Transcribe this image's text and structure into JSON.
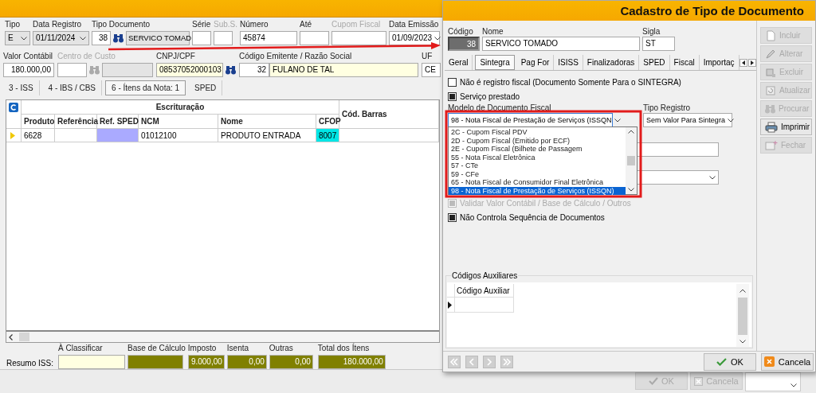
{
  "back_window": {
    "header_row_1": [
      {
        "kind": "combo",
        "label": "Tipo",
        "value": "E",
        "readonly": true,
        "disabled": false
      },
      {
        "kind": "combo",
        "label": "Data Registro",
        "value": "01/11/2024",
        "readonly": true,
        "disabled": false
      },
      {
        "kind": "lookup",
        "label": "Tipo Documento",
        "code": "38",
        "value": "SERVICO TOMAD",
        "readonly": true,
        "disabled": false
      },
      {
        "kind": "text",
        "label": "Série",
        "readonly": false,
        "disabled": false
      },
      {
        "kind": "text",
        "label": "Sub.S.",
        "readonly": false,
        "disabled": true
      },
      {
        "kind": "text",
        "label": "Número",
        "value": "45874",
        "readonly": false,
        "disabled": false
      },
      {
        "kind": "text",
        "label": "Até",
        "readonly": false,
        "disabled": false
      },
      {
        "kind": "text",
        "label": "Cupom Fiscal",
        "readonly": false,
        "disabled": true
      },
      {
        "kind": "combo",
        "label": "Data Emissão",
        "value": "01/09/2023",
        "readonly": false,
        "disabled": false
      }
    ],
    "header_row_2": [
      {
        "kind": "number",
        "label": "Valor Contábil",
        "value": "180.000,00",
        "highlighted": false,
        "disabled": false
      },
      {
        "kind": "lookup",
        "label": "Centro de Custo",
        "readonly": true,
        "disabled": true
      },
      {
        "kind": "search",
        "label": "CNPJ/CPF",
        "value": "08537052000103",
        "highlighted": true,
        "disabled": false
      },
      {
        "kind": "pair",
        "label": "Código Emitente / Razão Social",
        "code": "32",
        "value": "FULANO DE TAL",
        "highlighted": true,
        "disabled": false
      },
      {
        "kind": "text",
        "label": "UF",
        "value": "CE",
        "highlighted": false,
        "disabled": false
      }
    ],
    "tabs": [
      {
        "label": "3 - ISS",
        "selected": false
      },
      {
        "label": "4 - IBS / CBS",
        "selected": false
      },
      {
        "label": "6 - Ítens da Nota: 1",
        "selected": true
      },
      {
        "label": "SPED",
        "selected": false
      }
    ],
    "grid": {
      "group_header": "Escrituração",
      "columns": [
        "Produto",
        "Referência",
        "Ref. SPED",
        "NCM",
        "Nome",
        "CFOP"
      ],
      "extra_column": "Cód. Barras",
      "rows": [
        {
          "selected": true,
          "cells": [
            {
              "text": "6628"
            },
            {},
            {
              "color": "#aaaaff"
            },
            {
              "text": "01012100"
            },
            {
              "text": "PRODUTO ENTRADA"
            },
            {
              "text": "8007",
              "color": "#00e6e6"
            }
          ]
        }
      ]
    },
    "summary": {
      "label": "Resumo ISS:",
      "fields": [
        {
          "label": "À Classificar",
          "highlighted": true
        },
        {
          "label": "Base de Cálculo",
          "highlighted": false
        },
        {
          "label": "Imposto",
          "value": "9.000,00",
          "highlighted": false
        },
        {
          "label": "Isenta",
          "value": "0,00",
          "highlighted": false
        },
        {
          "label": "Outras",
          "value": "0,00",
          "highlighted": false
        },
        {
          "label": "Total dos Ítens",
          "value": "180.000,00",
          "highlighted": false
        }
      ]
    },
    "footer_buttons": [
      {
        "label": "OK",
        "disabled": true
      },
      {
        "label": "Cancela",
        "disabled": true
      }
    ]
  },
  "dialog": {
    "title": "Cadastro de Tipo de Documento",
    "codigo": {
      "label": "Código",
      "value": "38"
    },
    "nome": {
      "label": "Nome",
      "value": "SERVICO TOMADO"
    },
    "sigla": {
      "label": "Sigla",
      "value": "ST"
    },
    "tabs": [
      {
        "label": "Geral",
        "selected": false
      },
      {
        "label": "Sintegra",
        "selected": true
      },
      {
        "label": "Pag For",
        "selected": false
      },
      {
        "label": "ISISS",
        "selected": false
      },
      {
        "label": "Finalizadoras",
        "selected": false
      },
      {
        "label": "SPED",
        "selected": false
      },
      {
        "label": "Fiscal",
        "selected": false
      },
      {
        "label": "Importaç",
        "selected": false
      }
    ],
    "options_top": [
      {
        "label": "Não é registro fiscal (Documento Somente Para o SINTEGRA)",
        "checked": false,
        "disabled": false
      },
      {
        "label": "Serviço prestado",
        "checked": true,
        "disabled": false
      }
    ],
    "modelo": {
      "label": "Modelo de Documento Fiscal",
      "value": "98 - Nota Fiscal de Prestação de Serviços (ISSQN"
    },
    "tipo_registro": {
      "label": "Tipo Registro",
      "value": "Sem Valor Para Sintegra"
    },
    "modelo_options": [
      {
        "label": "2C - Cupom Fiscal PDV",
        "selected": false
      },
      {
        "label": "2D - Cupom Fiscal (Emitido por ECF)",
        "selected": false
      },
      {
        "label": "2E - Cupom Fiscal (Bilhete de Passagem",
        "selected": false
      },
      {
        "label": "55 - Nota Fiscal Eletrônica",
        "selected": false
      },
      {
        "label": "57 - CTe",
        "selected": false
      },
      {
        "label": "59 - CFe",
        "selected": false
      },
      {
        "label": "65 - Nota Fiscal de Consumidor Final Eletrônica",
        "selected": false
      },
      {
        "label": "98 - Nota Fiscal de Prestação de Serviços (ISSQN)",
        "selected": true
      }
    ],
    "options_bottom": [
      {
        "label": "Validar Valor Contábil / Base de Cálculo / Outros",
        "checked": true,
        "disabled": true
      },
      {
        "label": "Não Controla Sequência de Documentos",
        "checked": true,
        "disabled": false
      }
    ],
    "codigos_auxiliares": {
      "title": "Códigos Auxiliares",
      "column": "Código Auxiliar"
    },
    "side_buttons": [
      {
        "label": "Incluir",
        "disabled": true
      },
      {
        "label": "Alterar",
        "disabled": true
      },
      {
        "label": "Excluir",
        "disabled": true
      },
      {
        "label": "Atualizar",
        "disabled": true
      },
      {
        "label": "Procurar",
        "disabled": true
      },
      {
        "label": "Imprimir",
        "disabled": false
      },
      {
        "label": "Fechar",
        "disabled": true
      }
    ],
    "buttons": [
      {
        "label": "OK"
      },
      {
        "label": "Cancela"
      }
    ]
  }
}
